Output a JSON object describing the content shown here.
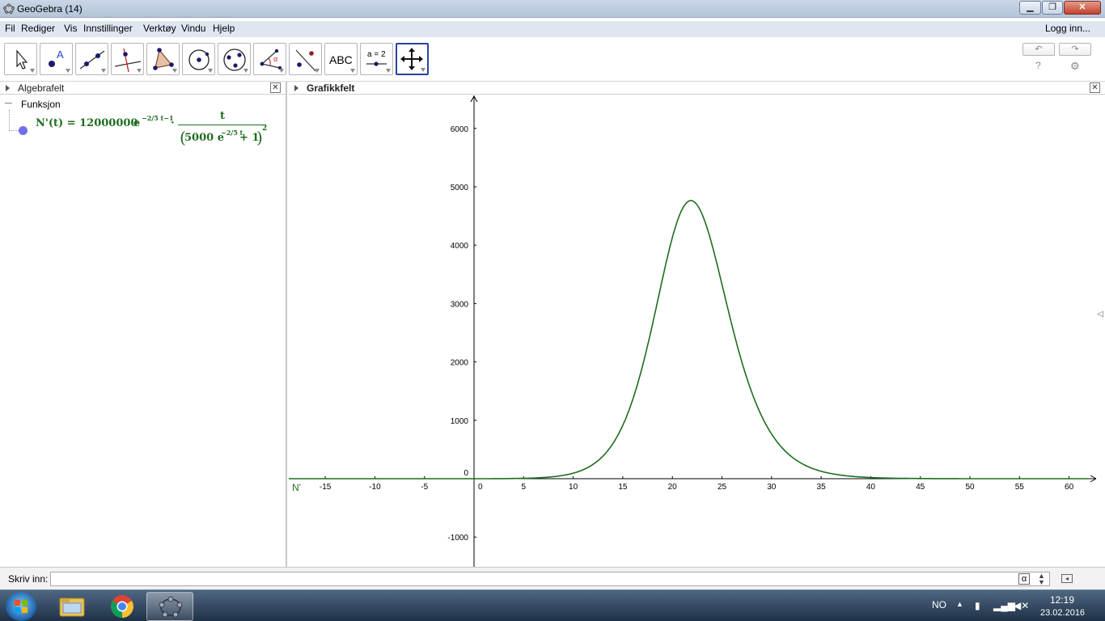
{
  "window": {
    "title": "GeoGebra (14)",
    "min_icon": "minimize-icon",
    "max_icon": "maximize-icon",
    "close_icon": "close-icon"
  },
  "menu": {
    "items": [
      "Fil",
      "Rediger",
      "Vis",
      "Innstillinger",
      "Verktøy",
      "Vindu",
      "Hjelp"
    ],
    "login": "Logg inn..."
  },
  "toolbar": {
    "tools": [
      "move-tool-icon",
      "point-tool-icon",
      "line-tool-icon",
      "perpendicular-line-tool-icon",
      "polygon-tool-icon",
      "circle-tool-icon",
      "conic-tool-icon",
      "angle-tool-icon",
      "reflect-tool-icon",
      "text-tool-icon",
      "slider-tool-icon",
      "move-graphics-view-tool-icon"
    ],
    "text_tool_label": "ABC",
    "slider_tool_label": "a = 2",
    "undo": "↶",
    "redo": "↷",
    "help": "?",
    "settings": "⚙"
  },
  "algebra": {
    "title": "Algebrafelt",
    "category": "Funksjon",
    "formula": {
      "lhs": "N'(t) = 12000000",
      "e1": "e",
      "exp1": "−2/5 t−1",
      "dot": "·",
      "num": "t",
      "den_a": "5000 e",
      "exp2": "−2/5 t",
      "den_b": "+ 1",
      "pow": "2"
    }
  },
  "graphics": {
    "title": "Grafikkfelt",
    "curve_label": "N'",
    "curve_color": "#1f6d1f"
  },
  "chart_data": {
    "type": "line",
    "function": "N'(t) = 12000000 e^(−2/5 t−1) · t / (5000 e^(−2/5 t) + 1)^2",
    "xlim": [
      -19,
      62
    ],
    "ylim": [
      -1500,
      6600
    ],
    "x_ticks": [
      -15,
      -10,
      -5,
      0,
      5,
      10,
      15,
      20,
      25,
      30,
      35,
      40,
      45,
      50,
      55,
      60
    ],
    "y_ticks": [
      -1000,
      0,
      1000,
      2000,
      3000,
      4000,
      5000,
      6000
    ],
    "peak": {
      "x": 21.8,
      "y": 4750
    },
    "grid": false
  },
  "input": {
    "label": "Skriv inn:",
    "value": "",
    "alpha": "α",
    "spinner": "▲▼",
    "keyboard_icon": "keyboard-icon"
  },
  "taskbar": {
    "language": "NO",
    "tray_up": "▲",
    "time": "12:19",
    "date": "23.02.2016"
  }
}
